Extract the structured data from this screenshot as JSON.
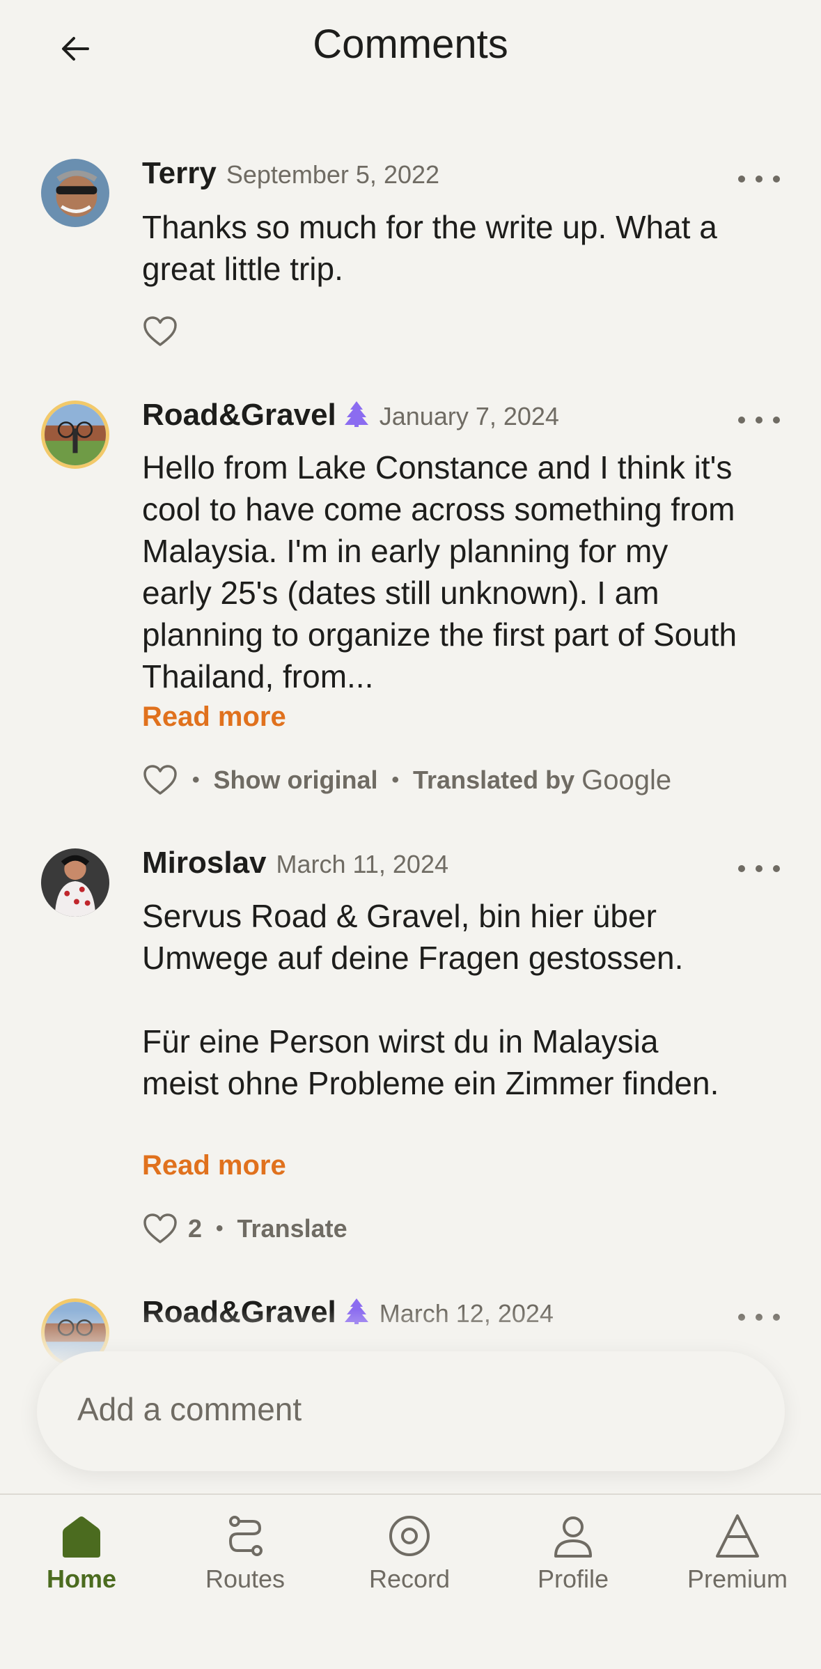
{
  "header": {
    "title": "Comments"
  },
  "comments": [
    {
      "name": "Terry",
      "date": "September 5, 2022",
      "body": [
        "Thanks so much for the write up. What a great little trip."
      ]
    },
    {
      "name": "Road&Gravel",
      "date": "January 7, 2024",
      "body": [
        "Hello from Lake Constance and I think it's cool to have come across something from Malaysia. I'm in early planning for my early 25's (dates still unknown). I am planning to organize the first part of South Thailand, from..."
      ],
      "read_more": "Read more",
      "show_original": "Show original",
      "translated_by": "Translated by",
      "google": "Google"
    },
    {
      "name": "Miroslav",
      "date": "March 11, 2024",
      "body": [
        "Servus Road & Gravel, bin hier über Umwege auf deine Fragen gestossen.",
        "Für eine Person wirst du in Malaysia meist ohne Probleme ein Zimmer finden."
      ],
      "read_more": "Read more",
      "likes": "2",
      "translate": "Translate"
    },
    {
      "name": "Road&Gravel",
      "date": "March 12, 2024"
    }
  ],
  "input": {
    "placeholder": "Add a comment"
  },
  "nav": [
    {
      "label": "Home",
      "icon": "home-icon",
      "active": true
    },
    {
      "label": "Routes",
      "icon": "routes-icon"
    },
    {
      "label": "Record",
      "icon": "record-icon"
    },
    {
      "label": "Profile",
      "icon": "profile-icon"
    },
    {
      "label": "Premium",
      "icon": "premium-icon"
    }
  ],
  "colors": {
    "accent": "#e0711d",
    "nav_active": "#4b6b1f",
    "premium_badge": "#8b6cf0",
    "background": "#f4f3ef"
  }
}
